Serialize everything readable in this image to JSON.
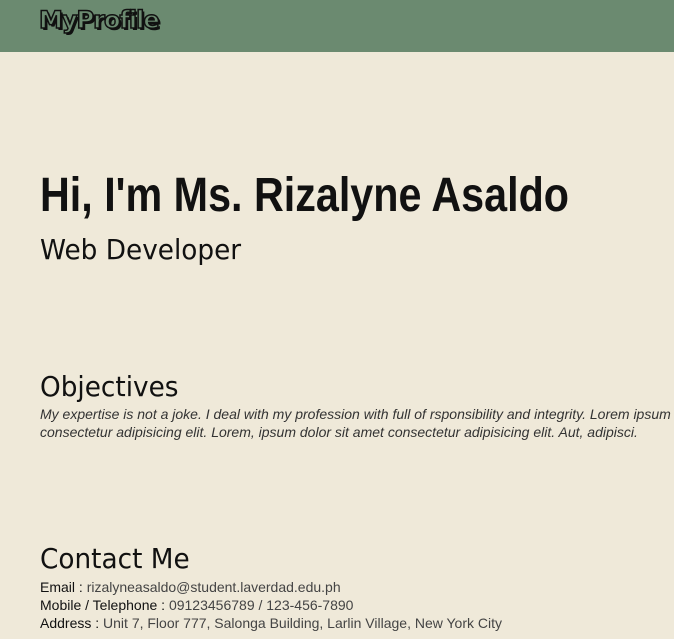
{
  "header": {
    "logo": "MyProfile"
  },
  "hero": {
    "name": "Hi, I'm Ms. Rizalyne Asaldo",
    "role": "Web Developer"
  },
  "objectives": {
    "title": "Objectives",
    "line1": "My expertise is not a joke. I deal with my profession with full of rsponsibility and integrity. Lorem ipsum dolor sit amet",
    "line2": "consectetur adipisicing elit. Lorem, ipsum dolor sit amet consectetur adipisicing elit. Aut, adipisci."
  },
  "contact": {
    "title": "Contact Me",
    "items": [
      {
        "label": "Email :",
        "value": "rizalyneasaldo@student.laverdad.edu.ph"
      },
      {
        "label": "Mobile / Telephone :",
        "value": "09123456789 / 123-456-7890"
      },
      {
        "label": "Address :",
        "value": "Unit 7, Floor 777, Salonga Building, Larlin Village, New York City"
      }
    ]
  },
  "colors": {
    "header_bg": "#6b8a70",
    "page_bg": "#efe9d9"
  }
}
